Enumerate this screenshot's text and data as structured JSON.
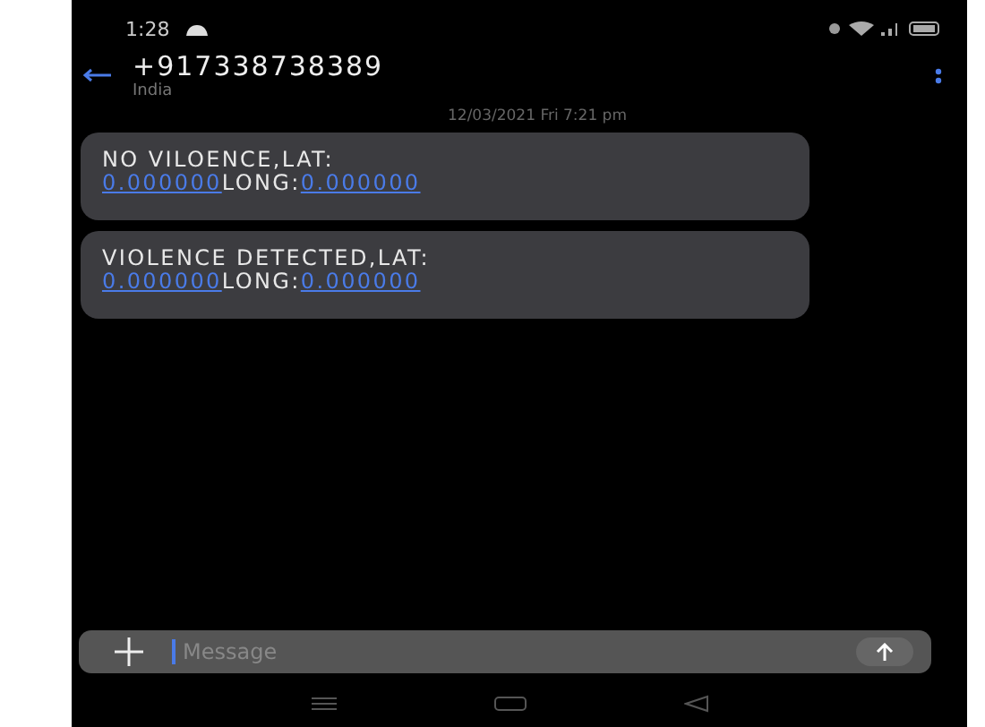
{
  "status_bar": {
    "time": "1:28"
  },
  "header": {
    "title": "+917338738389",
    "subtitle": "India"
  },
  "date": "12/03/2021 Fri 7:21 pm",
  "messages": [
    {
      "lines": [
        [
          {
            "text": "NO VILOENCE,LAT:",
            "link": false
          }
        ],
        [
          {
            "text": "0.000000",
            "link": true
          },
          {
            "text": "LONG:",
            "link": false
          },
          {
            "text": "0.000000",
            "link": true
          }
        ]
      ]
    },
    {
      "lines": [
        [
          {
            "text": "VIOLENCE DETECTED,LAT:",
            "link": false
          }
        ],
        [
          {
            "text": "0.000000",
            "link": true
          },
          {
            "text": "LONG:",
            "link": false
          },
          {
            "text": "0.000000",
            "link": true
          }
        ]
      ]
    }
  ],
  "composer": {
    "placeholder": "Message"
  }
}
